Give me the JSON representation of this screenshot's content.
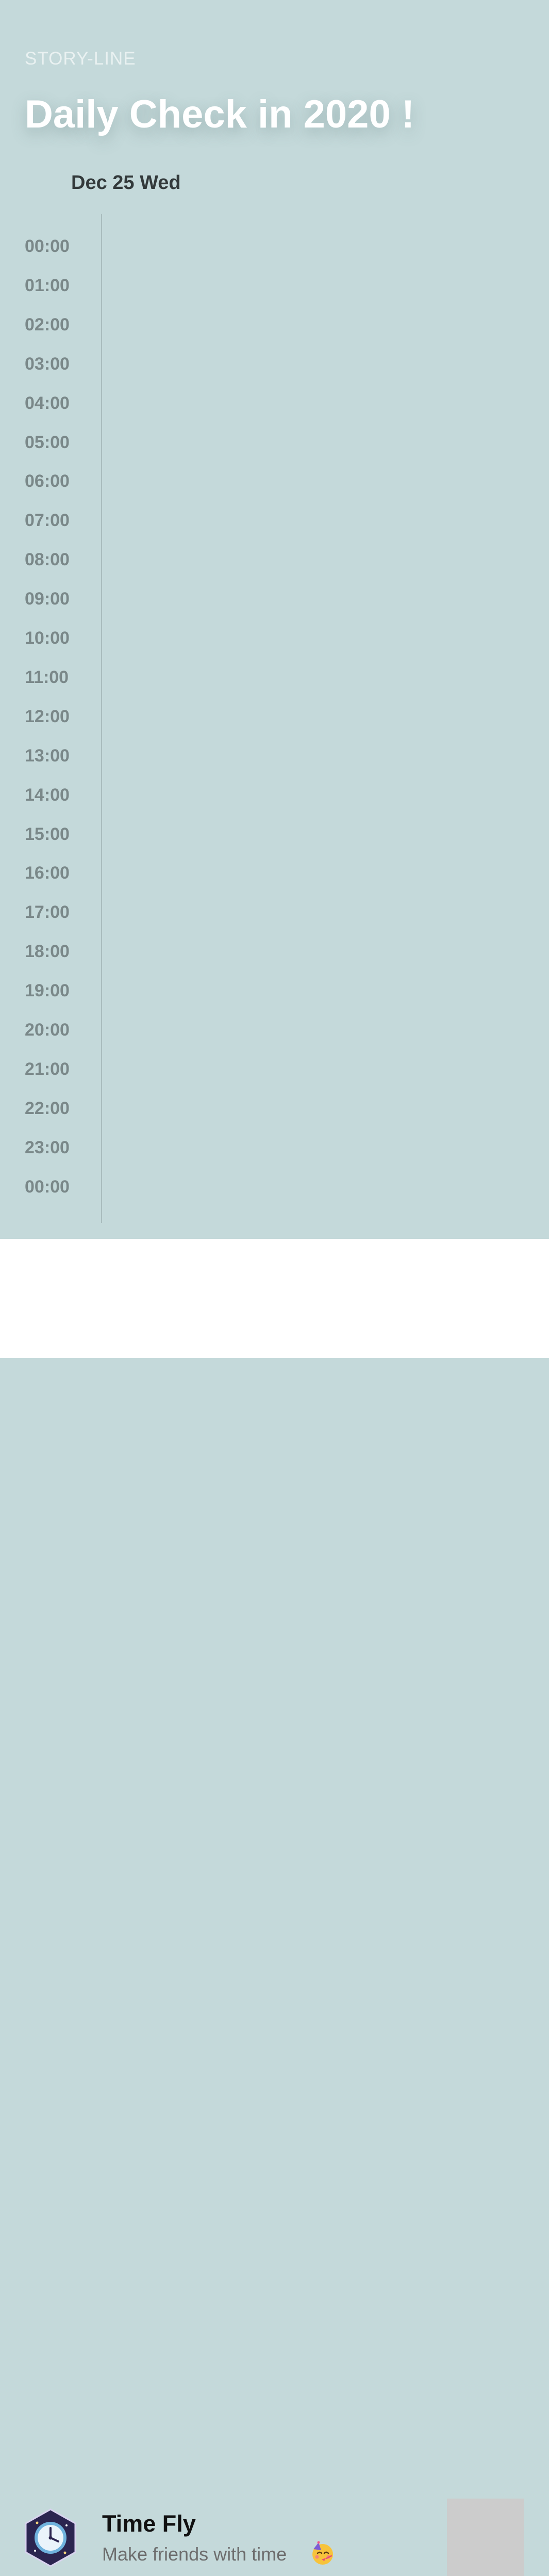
{
  "header": {
    "eyebrow": "STORY-LINE",
    "title": "Daily Check in 2020 !"
  },
  "day": {
    "label": "Dec 25 Wed"
  },
  "timeline": {
    "hours": [
      "00:00",
      "01:00",
      "02:00",
      "03:00",
      "04:00",
      "05:00",
      "06:00",
      "07:00",
      "08:00",
      "09:00",
      "10:00",
      "11:00",
      "12:00",
      "13:00",
      "14:00",
      "15:00",
      "16:00",
      "17:00",
      "18:00",
      "19:00",
      "20:00",
      "21:00",
      "22:00",
      "23:00",
      "00:00"
    ]
  },
  "banner": {
    "app_name": "Time Fly",
    "tagline": "Make friends with time",
    "app_icon": "clock-hexagon-icon",
    "tagline_emoji": "party-face-emoji"
  },
  "colors": {
    "background": "#c4d9da",
    "title": "#ffffff",
    "hour_label": "#7a8889",
    "ad_placeholder": "#cccccc"
  }
}
